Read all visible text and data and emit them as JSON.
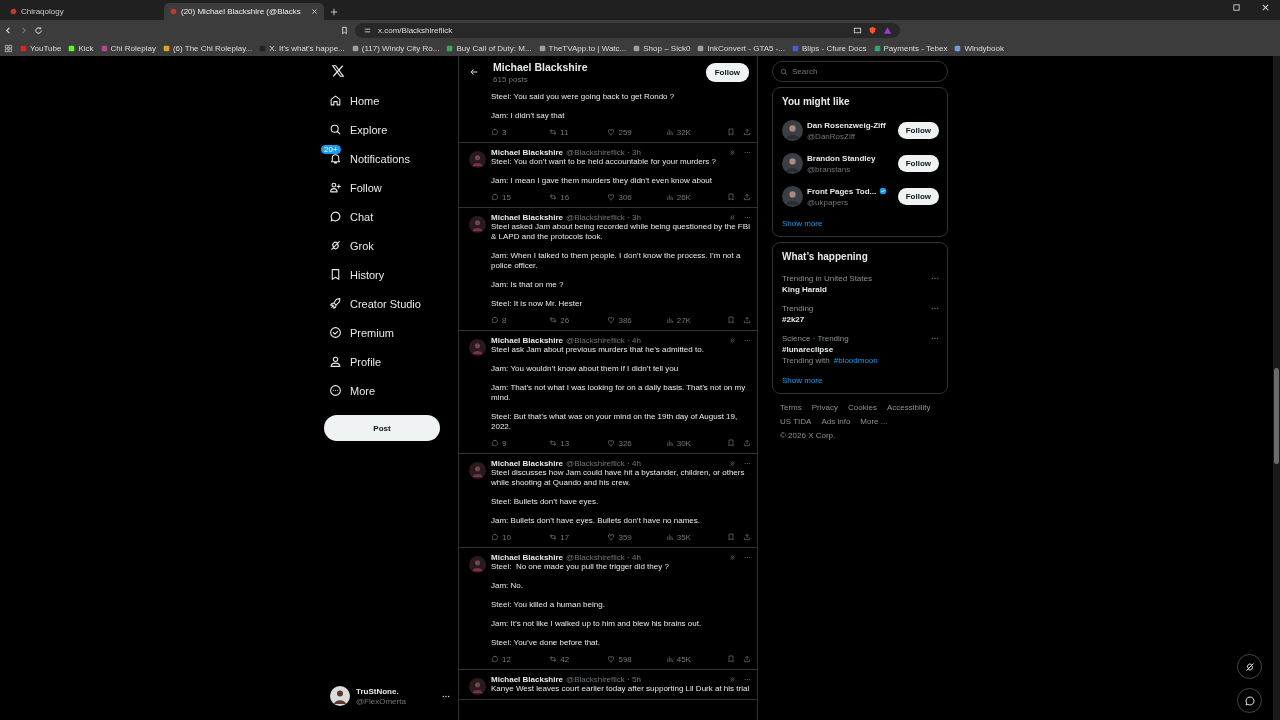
{
  "browser": {
    "tabs": [
      {
        "title": "Chiraqology",
        "selected": false
      },
      {
        "title": "(20) Michael Blackshire (@Blacks",
        "selected": true
      }
    ],
    "url": "x.com/Blackshireflick",
    "bookmarks": [
      {
        "label": "YouTube",
        "color": "#e62117"
      },
      {
        "label": "Kick",
        "color": "#53fc18"
      },
      {
        "label": "Chi Roleplay",
        "color": "#b04a8a"
      },
      {
        "label": "(6) The Chi Roleplay...",
        "color": "#d9a520"
      },
      {
        "label": "X. It's what's happe...",
        "color": "#222222"
      },
      {
        "label": "(117) Windy City Ro...",
        "color": "#9aa0a6"
      },
      {
        "label": "Buy Call of Duty: M...",
        "color": "#3aa757"
      },
      {
        "label": "TheTVApp.to | Watc...",
        "color": "#9aa0a6"
      },
      {
        "label": "Shop – Sick0",
        "color": "#9aa0a6"
      },
      {
        "label": "InkConvert - GTA5 -...",
        "color": "#9aa0a6"
      },
      {
        "label": "Blips - Cfure Docs",
        "color": "#4a5bd4"
      },
      {
        "label": "Payments - Tebex",
        "color": "#2ea86b"
      },
      {
        "label": "Windybook",
        "color": "#6f9be0"
      }
    ]
  },
  "nav": {
    "items": [
      {
        "label": "Home"
      },
      {
        "label": "Explore"
      },
      {
        "label": "Notifications",
        "badge": "20+"
      },
      {
        "label": "Follow"
      },
      {
        "label": "Chat"
      },
      {
        "label": "Grok"
      },
      {
        "label": "History"
      },
      {
        "label": "Creator Studio"
      },
      {
        "label": "Premium"
      },
      {
        "label": "Profile"
      },
      {
        "label": "More"
      }
    ],
    "post_button": "Post",
    "account": {
      "name": "TruStNone.",
      "handle": "@FlexOmerta"
    }
  },
  "profile": {
    "name": "Michael Blackshire",
    "posts": "615 posts",
    "follow_button": "Follow"
  },
  "tweets": [
    {
      "body": [
        "Steel: You said you were going back to get Rondo ?",
        "Jam: I didn’t say that"
      ],
      "stats": [
        "3",
        "11",
        "259",
        "32K"
      ]
    },
    {
      "author": "Michael Blackshire",
      "handle": "@Blackshireflick · 3h",
      "body": [
        "Steel: You don’t want to be held accountable for your murders ?",
        "Jam: I mean I gave them murders they didn’t even know about"
      ],
      "stats": [
        "15",
        "16",
        "306",
        "26K"
      ]
    },
    {
      "author": "Michael Blackshire",
      "handle": "@Blackshireflick · 3h",
      "body": [
        "Steel asked Jam about being recorded while being questioned by the FBI & LAPD and the protocols took.",
        "Jam: When I talked to them people. I don’t know the process. I’m not a police officer.",
        "Jam: Is that on me ?",
        "Steel: It is now Mr. Hester"
      ],
      "stats": [
        "8",
        "26",
        "386",
        "27K"
      ]
    },
    {
      "author": "Michael Blackshire",
      "handle": "@Blackshireflick · 4h",
      "body": [
        "Steel ask Jam about previous murders that he’s admitted to.",
        "Jam: You wouldn’t know about them if I didn’t tell you",
        "Jam: That’s not what I was looking for on a daily basis. That’s not on my mind.",
        "Steel: But that’s what was on your mind on the 19th day of August 19, 2022."
      ],
      "stats": [
        "9",
        "13",
        "326",
        "30K"
      ]
    },
    {
      "author": "Michael Blackshire",
      "handle": "@Blackshireflick · 4h",
      "body": [
        "Steel discusses how Jam could have hit a bystander, children, or others while shooting at Quando and his crew.",
        "Steel: Bullets don’t have eyes.",
        "Jam: Bullets don’t have eyes. Bullets don’t have no names."
      ],
      "stats": [
        "10",
        "17",
        "359",
        "35K"
      ]
    },
    {
      "author": "Michael Blackshire",
      "handle": "@Blackshireflick · 4h",
      "body": [
        "Steel:  No one made you pull the trigger did they ?",
        "Jam: No.",
        "Steel: You killed a human being.",
        "Jam: It’s not like I walked up to him and blew his brains out.",
        "Steel: You’ve done before that."
      ],
      "stats": [
        "12",
        "42",
        "598",
        "45K"
      ]
    },
    {
      "author": "Michael Blackshire",
      "handle": "@Blackshireflick · 5h",
      "body": [
        "Kanye West leaves court earlier today after supporting Lil Durk at his trial"
      ]
    }
  ],
  "right": {
    "search": {
      "placeholder": "Search"
    },
    "you_might_like": {
      "title": "You might like",
      "users": [
        {
          "name": "Dan Rosenzweig-Ziff",
          "handle": "@DanRosZiff",
          "verified": false,
          "follow": "Follow"
        },
        {
          "name": "Brandon Standley",
          "handle": "@branstans",
          "verified": false,
          "follow": "Follow"
        },
        {
          "name": "Front Pages Tod...",
          "handle": "@ukpapers",
          "verified": true,
          "follow": "Follow"
        }
      ],
      "show_more": "Show more"
    },
    "whats_happening": {
      "title": "What’s happening",
      "trends": [
        {
          "context": "Trending in United States",
          "topic": "King Harald"
        },
        {
          "context": "Trending",
          "topic": "#2k27"
        },
        {
          "context": "Science · Trending",
          "topic": "#lunareclipse",
          "with_label": "Trending with",
          "with_tag": "#bloodmoon"
        }
      ],
      "show_more": "Show more"
    },
    "footer": [
      "Terms",
      "Privacy",
      "Cookies",
      "Accessibility",
      "US TIDA",
      "Ads info",
      "More ...",
      "© 2026 X Corp."
    ]
  }
}
